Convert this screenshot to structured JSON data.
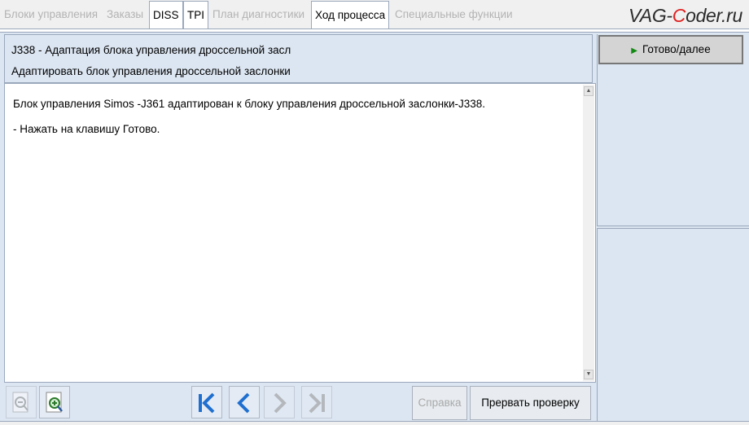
{
  "tabs": [
    {
      "label": "Блоки управления",
      "active": false
    },
    {
      "label": "Заказы",
      "active": false
    },
    {
      "label": "DISS",
      "active": true
    },
    {
      "label": "TPI",
      "active": true
    },
    {
      "label": "План диагностики",
      "active": false
    },
    {
      "label": "Ход процесса",
      "active": true
    },
    {
      "label": "Специальные функции",
      "active": false
    }
  ],
  "watermark": {
    "before": "VAG-",
    "accent": "C",
    "after": "oder.ru"
  },
  "header": {
    "line1": "J338 - Адаптация блока управления дроссельной засл",
    "line2": "Адаптировать блок управления дроссельной заслонки"
  },
  "content": {
    "paragraph1": "Блок управления Simos -J361 адаптирован к блоку управления дроссельной заслонки-J338.",
    "paragraph2": "- Нажать на клавишу Готово."
  },
  "side": {
    "done_label": "Готово/далее"
  },
  "toolbar": {
    "help_label": "Справка",
    "abort_label": "Прервать проверку"
  },
  "colors": {
    "panel": "#dce6f2",
    "border": "#9aa8bc",
    "nav_blue": "#1f6fd0",
    "play_green": "#138a13"
  },
  "icons": [
    "zoom-out-icon",
    "zoom-in-icon",
    "first-icon",
    "back-icon",
    "forward-icon",
    "last-icon",
    "play-icon"
  ]
}
